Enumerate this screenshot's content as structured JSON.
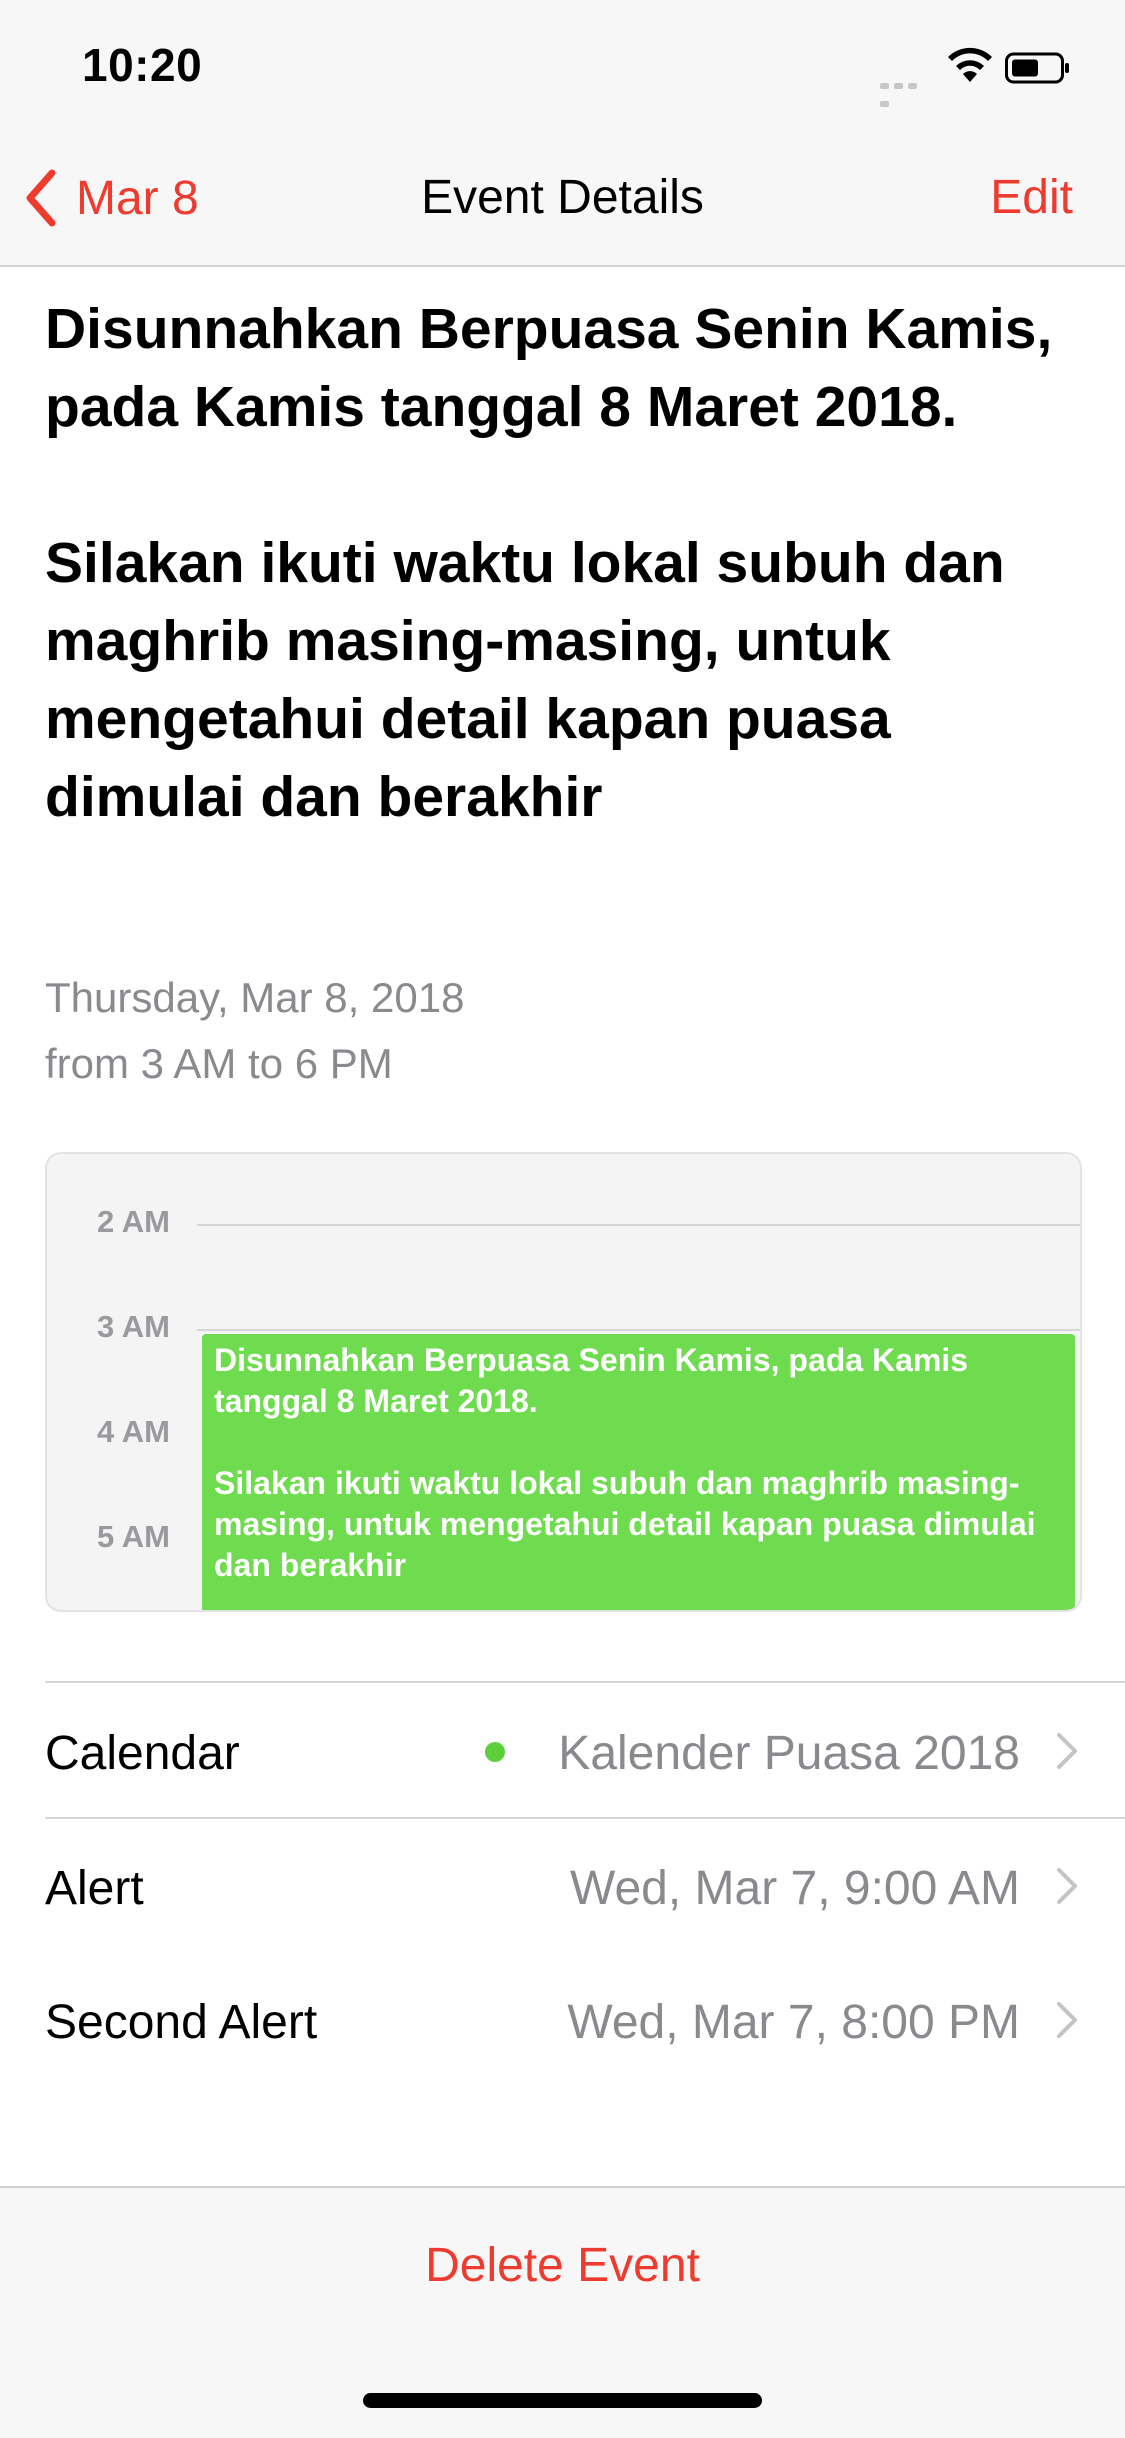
{
  "status_bar": {
    "time": "10:20",
    "signal_icon": "signal-dots-icon",
    "wifi_icon": "wifi-icon",
    "battery_icon": "battery-icon"
  },
  "nav": {
    "back_label": "Mar 8",
    "title": "Event Details",
    "edit_label": "Edit",
    "accent_color": "#ee3b2f"
  },
  "event": {
    "title_line1": "Disunnahkan Berpuasa Senin Kamis, pada Kamis tanggal 8 Maret 2018.",
    "title_line2": "Silakan ikuti waktu lokal subuh dan maghrib masing-masing, untuk mengetahui detail kapan puasa dimulai dan berakhir",
    "date": "Thursday, Mar 8, 2018",
    "time_range": "from 3 AM to 6 PM"
  },
  "day_preview": {
    "hours": [
      "2 AM",
      "3 AM",
      "4 AM",
      "5 AM"
    ],
    "block_line1": "Disunnahkan Berpuasa Senin Kamis, pada Kamis tanggal 8 Maret 2018.",
    "block_line2": "Silakan ikuti waktu lokal subuh dan maghrib masing-masing, untuk mengetahui detail kapan puasa dimulai dan berakhir",
    "block_color": "#6fdc4f"
  },
  "rows": [
    {
      "label": "Calendar",
      "value": "Kalender Puasa 2018",
      "dot_color": "#5ccf3b"
    },
    {
      "label": "Alert",
      "value": "Wed, Mar 7, 9:00 AM"
    },
    {
      "label": "Second Alert",
      "value": "Wed, Mar 7, 8:00 PM"
    }
  ],
  "delete_label": "Delete Event"
}
